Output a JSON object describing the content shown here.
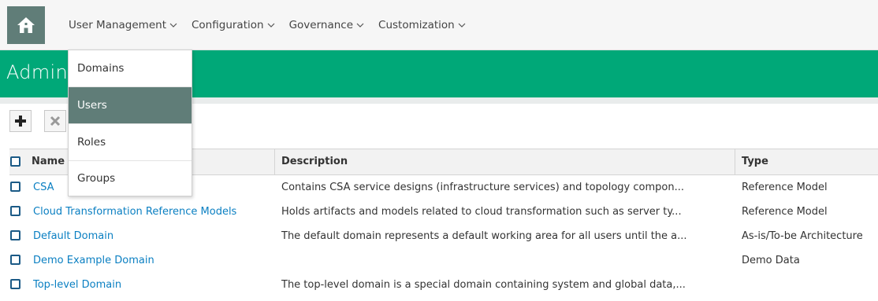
{
  "nav": {
    "items": [
      {
        "label": "User Management"
      },
      {
        "label": "Configuration"
      },
      {
        "label": "Governance"
      },
      {
        "label": "Customization"
      }
    ]
  },
  "page": {
    "title": "Administration"
  },
  "menu": {
    "items": [
      {
        "label": "Domains",
        "active": false
      },
      {
        "label": "Users",
        "active": true
      },
      {
        "label": "Roles",
        "active": false
      },
      {
        "label": "Groups",
        "active": false
      }
    ]
  },
  "toolbar": {
    "add_icon": "plus-icon",
    "delete_icon": "x-icon"
  },
  "table": {
    "columns": [
      "Name",
      "Description",
      "Type"
    ],
    "rows": [
      {
        "name": "CSA",
        "description": "Contains CSA service designs (infrastructure services) and topology compon...",
        "type": "Reference Model"
      },
      {
        "name": "Cloud Transformation Reference Models",
        "description": "Holds artifacts and models related to cloud transformation such as server ty...",
        "type": "Reference Model"
      },
      {
        "name": "Default Domain",
        "description": "The default domain represents a default working area for all users until the a...",
        "type": "As-is/To-be Architecture"
      },
      {
        "name": "Demo Example Domain",
        "description": "",
        "type": "Demo Data"
      },
      {
        "name": "Top-level Domain",
        "description": "The top-level domain is a special domain containing system and global data,...",
        "type": ""
      }
    ]
  },
  "colors": {
    "accent_green": "#00a878",
    "menu_active": "#607d78",
    "link": "#0a7fc2"
  }
}
